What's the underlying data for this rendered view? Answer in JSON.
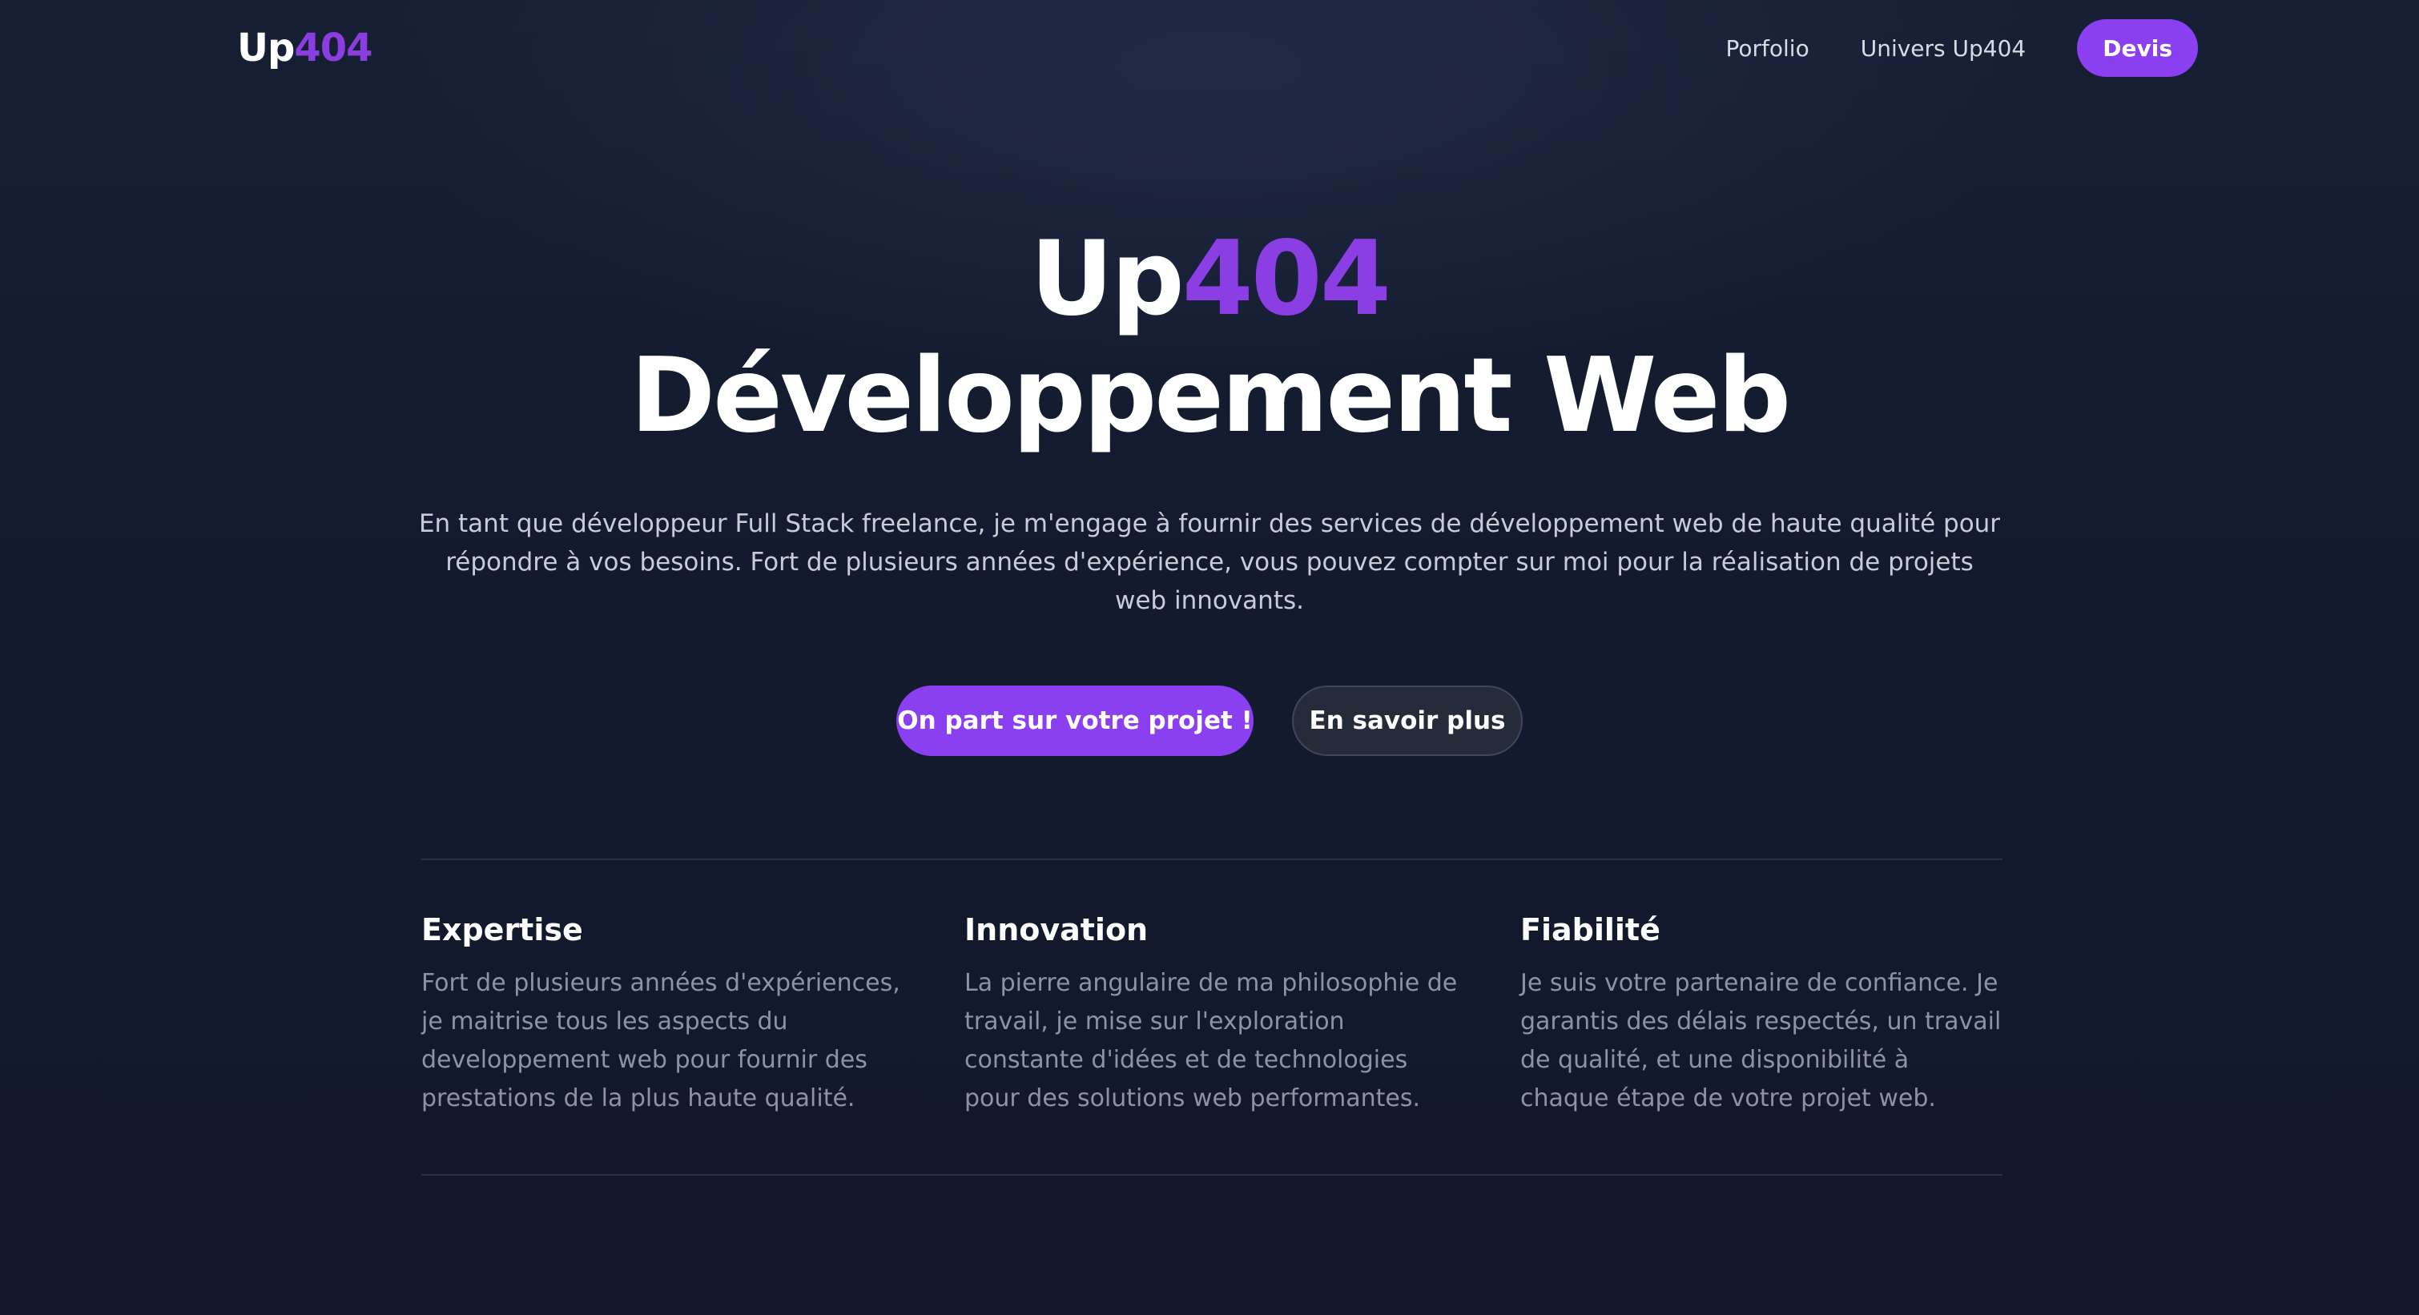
{
  "nav": {
    "logo_prefix": "Up",
    "logo_accent": "404",
    "links": [
      "Porfolio",
      "Univers Up404"
    ],
    "cta": "Devis"
  },
  "hero": {
    "title_prefix": "Up",
    "title_accent": "404",
    "title_line2": "Développement Web",
    "subtitle": "En tant que développeur Full Stack freelance, je m'engage à fournir des services de développement web de haute qualité pour répondre à vos besoins. Fort de plusieurs années d'expérience, vous pouvez compter sur moi pour la réalisation de projets web innovants.",
    "primary_cta": "On part sur votre projet !",
    "secondary_cta": "En savoir plus"
  },
  "features": [
    {
      "title": "Expertise",
      "text": "Fort de plusieurs années d'expériences, je maitrise tous les aspects du developpement web pour fournir des prestations de la plus haute qualité."
    },
    {
      "title": "Innovation",
      "text": "La pierre angulaire de ma philosophie de travail, je mise sur l'exploration constante d'idées et de technologies pour des solutions web performantes."
    },
    {
      "title": "Fiabilité",
      "text": "Je suis votre partenaire de confiance. Je garantis des délais respectés, un travail de qualité, et une disponibilité à chaque étape de votre projet web."
    }
  ],
  "colors": {
    "accent": "#8a3ff0",
    "background": "#141a2e",
    "muted_text": "#8e93a3"
  }
}
